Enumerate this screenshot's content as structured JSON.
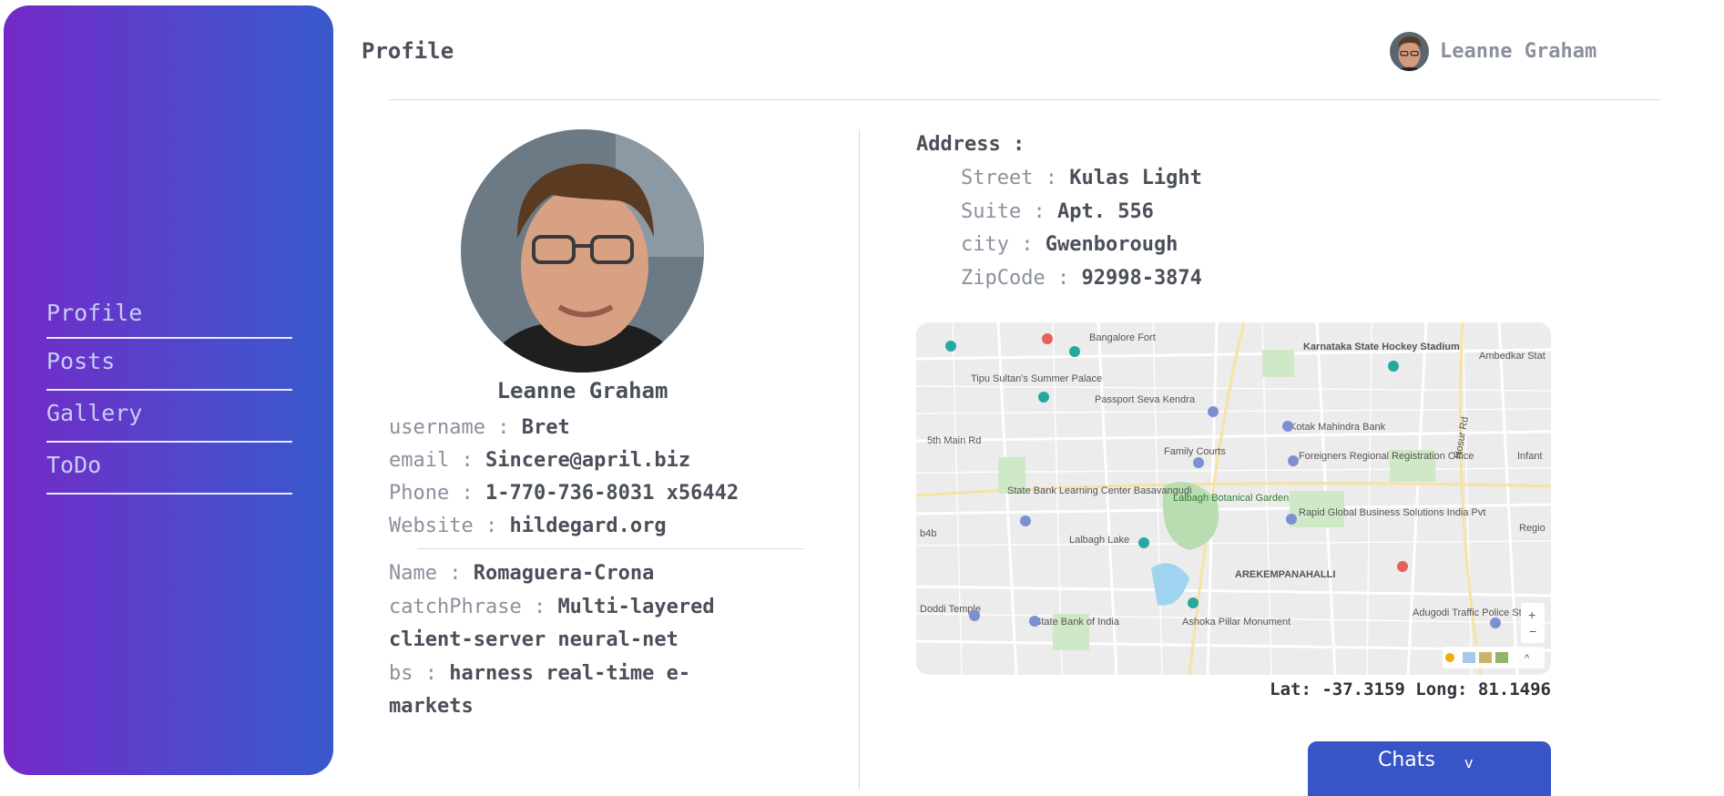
{
  "sidebar": {
    "items": [
      {
        "label": "Profile"
      },
      {
        "label": "Posts"
      },
      {
        "label": "Gallery"
      },
      {
        "label": "ToDo"
      }
    ]
  },
  "header": {
    "title": "Profile",
    "user_name": "Leanne Graham"
  },
  "profile": {
    "full_name": "Leanne Graham",
    "fields": [
      {
        "label": "username :",
        "value": "Bret"
      },
      {
        "label": "email :",
        "value": "Sincere@april.biz"
      },
      {
        "label": "Phone :",
        "value": "1-770-736-8031 x56442"
      },
      {
        "label": "Website :",
        "value": "hildegard.org"
      }
    ],
    "company": {
      "name_label": "Name :",
      "name": "Romaguera-Crona",
      "catchphrase_label": "catchPhrase :",
      "catchphrase": "Multi-layered client-server neural-net",
      "bs_label": "bs :",
      "bs": "harness real-time e-markets"
    }
  },
  "address": {
    "title": "Address :",
    "fields": [
      {
        "label": "Street :",
        "value": "Kulas Light"
      },
      {
        "label": "Suite :",
        "value": "Apt. 556"
      },
      {
        "label": "city :",
        "value": "Gwenborough"
      },
      {
        "label": "ZipCode :",
        "value": "92998-3874"
      }
    ],
    "coords": "Lat: -37.3159 Long: 81.1496"
  },
  "map": {
    "labels": {
      "bangalore_fort": "Bangalore Fort",
      "tipu": "Tipu Sultan's Summer Palace",
      "passport": "Passport Seva Kendra",
      "kotak": "Kotak Mahindra Bank",
      "karnataka": "Karnataka State Hockey Stadium",
      "ambedkar": "Ambedkar Stat",
      "family_courts": "Family Courts",
      "frro": "Foreigners Regional Registration Office",
      "sbi_center": "State Bank Learning Center Basavangudi",
      "lalbagh_garden": "Lalbagh Botanical Garden",
      "lalbagh_lake": "Lalbagh Lake",
      "rapid": "Rapid Global Business Solutions India Pvt",
      "arekempanahalli": "AREKEMPANAHALLI",
      "sbi": "State Bank of India",
      "ashoka": "Ashoka Pillar Monument",
      "adugodi": "Adugodi Traffic Police Station",
      "main_rd": "5th Main Rd",
      "hosur_rd": "Hosur Rd",
      "doddi": "Doddi Temple",
      "infant": "Infant",
      "regio": "Regio",
      "b4b": "b4b"
    }
  },
  "chats": {
    "label": "Chats",
    "chevron": "v"
  },
  "colors": {
    "sidebar_start": "#7429c7",
    "sidebar_end": "#3859cc",
    "chats": "#3755c6"
  }
}
